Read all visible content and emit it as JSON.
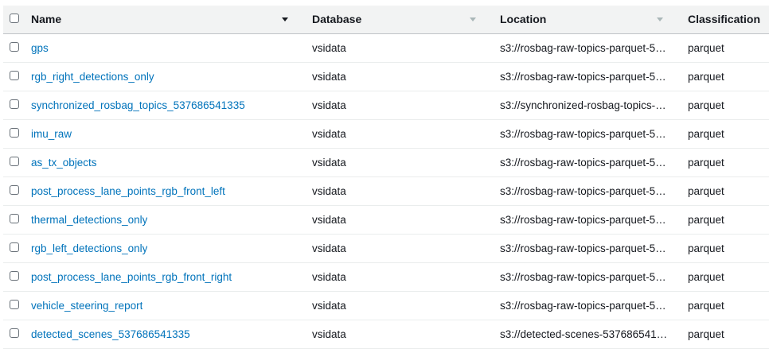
{
  "columns": {
    "name": "Name",
    "database": "Database",
    "location": "Location",
    "classification": "Classification"
  },
  "rows": [
    {
      "name": "gps",
      "database": "vsidata",
      "location": "s3://rosbag-raw-topics-parquet-5…",
      "classification": "parquet"
    },
    {
      "name": "rgb_right_detections_only",
      "database": "vsidata",
      "location": "s3://rosbag-raw-topics-parquet-5…",
      "classification": "parquet"
    },
    {
      "name": "synchronized_rosbag_topics_537686541335",
      "database": "vsidata",
      "location": "s3://synchronized-rosbag-topics-…",
      "classification": "parquet"
    },
    {
      "name": "imu_raw",
      "database": "vsidata",
      "location": "s3://rosbag-raw-topics-parquet-5…",
      "classification": "parquet"
    },
    {
      "name": "as_tx_objects",
      "database": "vsidata",
      "location": "s3://rosbag-raw-topics-parquet-5…",
      "classification": "parquet"
    },
    {
      "name": "post_process_lane_points_rgb_front_left",
      "database": "vsidata",
      "location": "s3://rosbag-raw-topics-parquet-5…",
      "classification": "parquet"
    },
    {
      "name": "thermal_detections_only",
      "database": "vsidata",
      "location": "s3://rosbag-raw-topics-parquet-5…",
      "classification": "parquet"
    },
    {
      "name": "rgb_left_detections_only",
      "database": "vsidata",
      "location": "s3://rosbag-raw-topics-parquet-5…",
      "classification": "parquet"
    },
    {
      "name": "post_process_lane_points_rgb_front_right",
      "database": "vsidata",
      "location": "s3://rosbag-raw-topics-parquet-5…",
      "classification": "parquet"
    },
    {
      "name": "vehicle_steering_report",
      "database": "vsidata",
      "location": "s3://rosbag-raw-topics-parquet-5…",
      "classification": "parquet"
    },
    {
      "name": "detected_scenes_537686541335",
      "database": "vsidata",
      "location": "s3://detected-scenes-537686541…",
      "classification": "parquet"
    }
  ]
}
